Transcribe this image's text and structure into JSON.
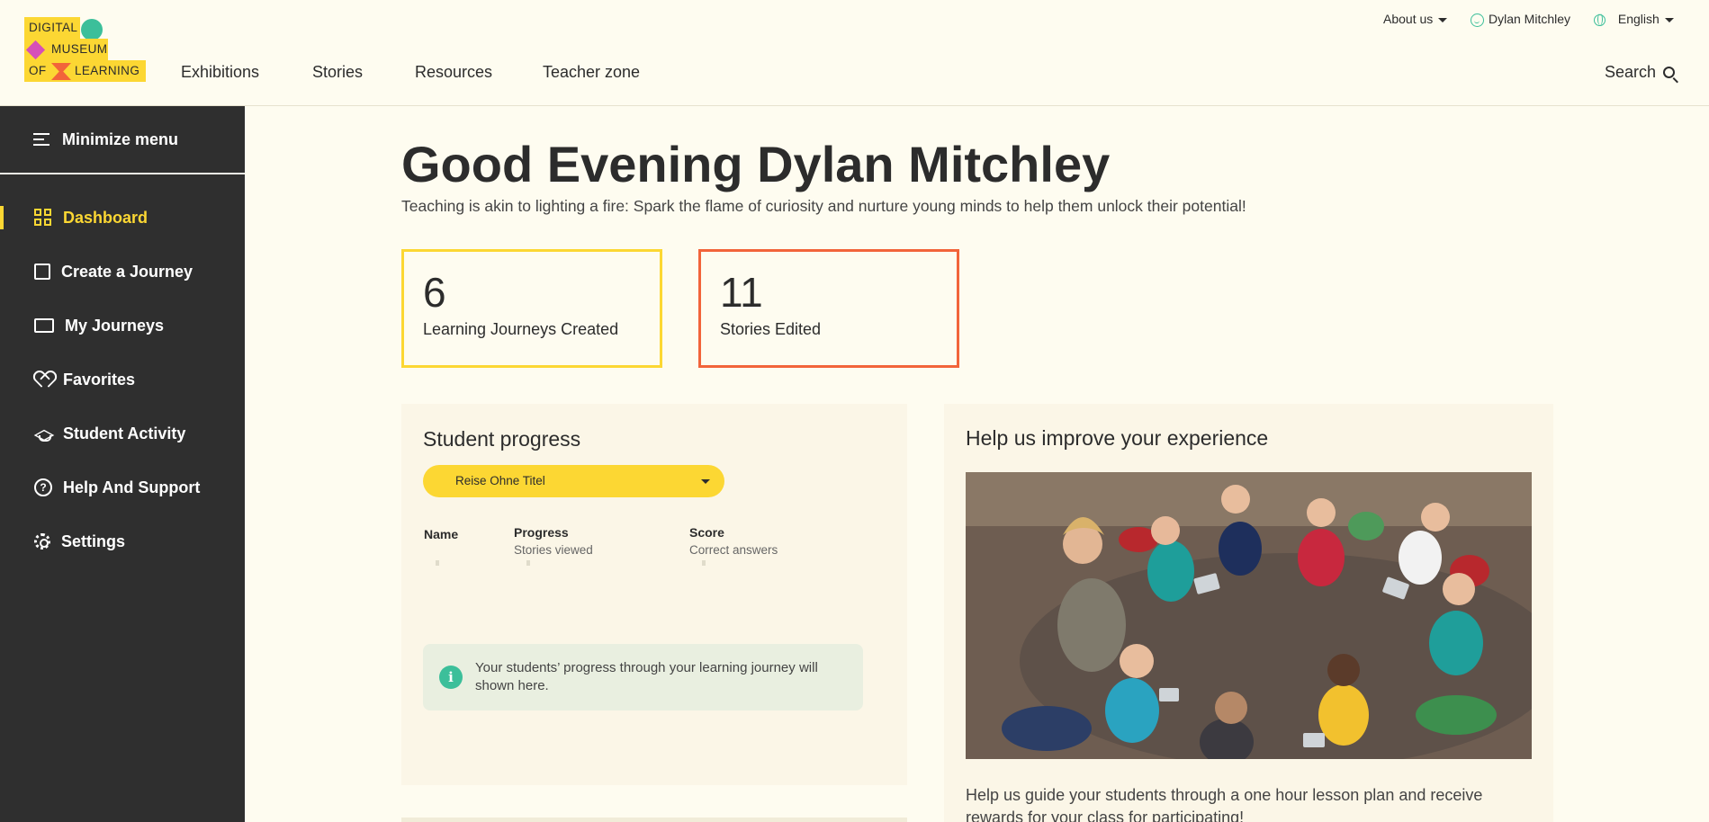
{
  "logo": {
    "line1": "DIGITAL",
    "line2": "MUSEUM",
    "line3_a": "OF",
    "line3_b": "LEARNING"
  },
  "main_nav": [
    "Exhibitions",
    "Stories",
    "Resources",
    "Teacher zone"
  ],
  "top_nav": {
    "about": "About us",
    "user": "Dylan Mitchley",
    "language": "English"
  },
  "search": {
    "label": "Search"
  },
  "sidebar": {
    "minimize": "Minimize menu",
    "items": [
      {
        "label": "Dashboard",
        "active": true
      },
      {
        "label": "Create a Journey"
      },
      {
        "label": "My Journeys"
      },
      {
        "label": "Favorites"
      },
      {
        "label": "Student Activity"
      },
      {
        "label": "Help And Support"
      },
      {
        "label": "Settings"
      }
    ]
  },
  "greeting": {
    "title": "Good Evening Dylan Mitchley",
    "tagline": "Teaching is akin to lighting a fire: Spark the flame of curiosity and nurture young minds to help them unlock their potential!"
  },
  "stats": [
    {
      "value": "6",
      "label": "Learning Journeys Created",
      "color": "#fcd733"
    },
    {
      "value": "11",
      "label": "Stories Edited",
      "color": "#f2643a"
    }
  ],
  "student_progress": {
    "title": "Student progress",
    "selected_journey": "Reise Ohne Titel",
    "columns": [
      {
        "header": "Name",
        "sub": ""
      },
      {
        "header": "Progress",
        "sub": "Stories viewed"
      },
      {
        "header": "Score",
        "sub": "Correct answers"
      }
    ],
    "info": "Your students’ progress through your learning journey will shown here."
  },
  "improve": {
    "title": "Help us improve your experience",
    "text": "Help us guide your students through a one hour lesson plan and receive rewards for your class for participating!"
  },
  "colors": {
    "accent_yellow": "#fcd733",
    "accent_orange": "#f2643a",
    "accent_green": "#3cbf9a",
    "sidebar_bg": "#2f2f2f",
    "page_bg": "#fefcf0"
  },
  "icons": [
    "menu-collapse-icon",
    "grid-icon",
    "image-add-icon",
    "gallery-icon",
    "heart-icon",
    "graduation-cap-icon",
    "question-icon",
    "gear-icon",
    "search-icon",
    "smiley-icon",
    "globe-icon",
    "info-icon"
  ]
}
